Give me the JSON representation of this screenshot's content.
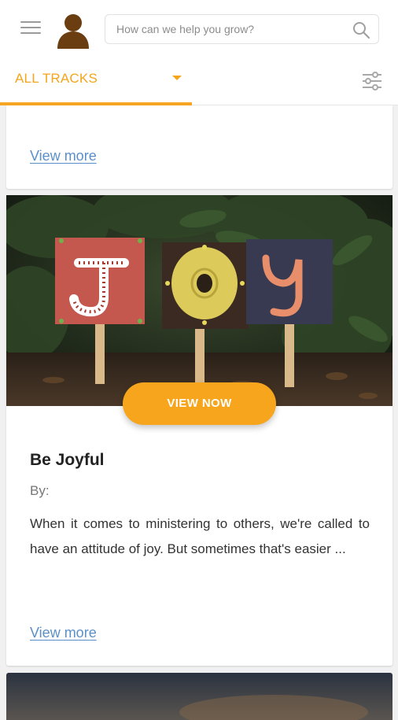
{
  "header": {
    "search_placeholder": "How can we help you grow?"
  },
  "tabs": {
    "active_label": "ALL TRACKS"
  },
  "previous_card": {
    "view_more": "View more"
  },
  "card": {
    "title": "Be Joyful",
    "by_label": "By:",
    "description": "When it comes to ministering to others, we're called to have an attitude of joy. But sometimes that's easier ...",
    "view_now": "VIEW NOW",
    "view_more": "View more"
  },
  "colors": {
    "accent": "#f6a51c",
    "link": "#5b8fc9"
  },
  "icons": [
    "hamburger-menu-icon",
    "user-avatar-icon",
    "search-icon",
    "filter-sliders-icon",
    "dropdown-caret-icon"
  ]
}
